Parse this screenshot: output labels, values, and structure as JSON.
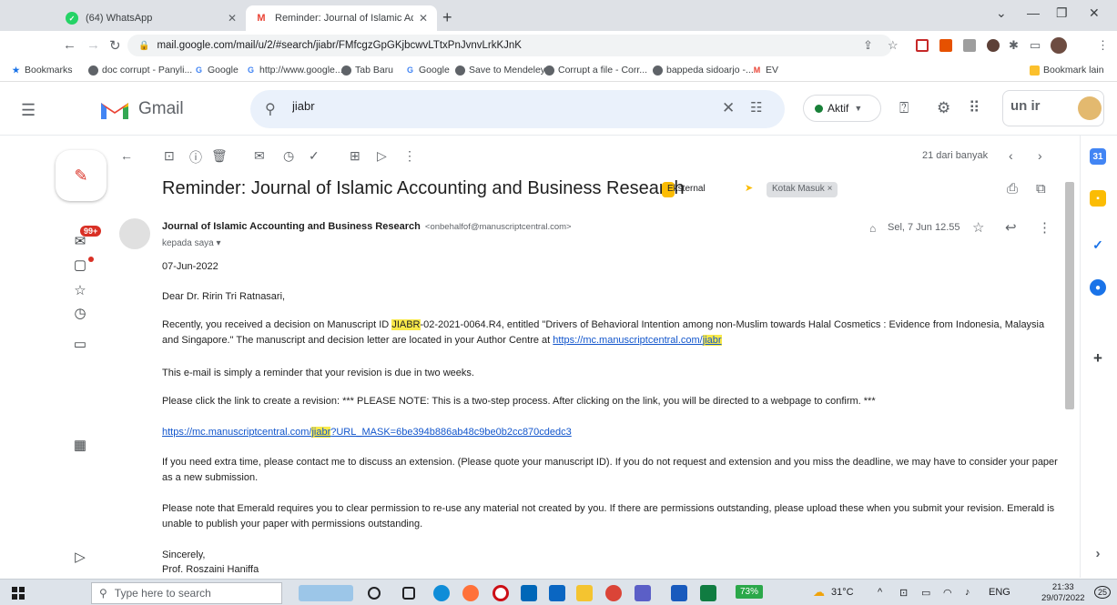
{
  "browser": {
    "tabs": [
      {
        "title": "(64) WhatsApp",
        "icon": "whatsapp-icon",
        "color": "#25d366"
      },
      {
        "title": "Reminder: Journal of Islamic Acc",
        "icon": "gmail-icon",
        "color": "#ea4335"
      }
    ],
    "url": "mail.google.com/mail/u/2/#search/jiabr/FMfcgzGpGKjbcwvLTtxPnJvnvLrkKJnK",
    "bookmarks": [
      "Bookmarks",
      "doc corrupt - Panyli...",
      "Google",
      "http://www.google....",
      "Tab Baru",
      "Google",
      "Save to Mendeley",
      "Corrupt a file - Corr...",
      "bappeda sidoarjo -...",
      "EV",
      "Bookmark lain"
    ]
  },
  "gmail": {
    "app_name": "Gmail",
    "search_value": "jiabr",
    "status_label": "Aktif",
    "status_color": "#188038",
    "org_logo_text": "un ir",
    "toolbar": {
      "pager_text": "21 dari banyak"
    },
    "unread_badge": "99+"
  },
  "email": {
    "subject": "Reminder: Journal of Islamic Accounting and Business Research",
    "labels": {
      "external": "Eksternal",
      "inbox": "Kotak Masuk ×"
    },
    "sender_name": "Journal of Islamic Accounting and Business Research",
    "sender_email": "<onbehalfof@manuscriptcentral.com>",
    "recipient": "kepada saya ▾",
    "date": "Sel, 7 Jun 12.55",
    "body": {
      "date_line": "07-Jun-2022",
      "greeting": "Dear Dr. Ririn Tri Ratnasari,",
      "p1_a": "Recently, you received a decision on Manuscript ID ",
      "p1_hl": "JIABR",
      "p1_b": "-02-2021-0064.R4, entitled \"Drivers of Behavioral Intention among non-Muslim towards Halal Cosmetics : Evidence from Indonesia, Malaysia and Singapore.\"  The manuscript and decision letter are located in your Author Centre at ",
      "p1_link_a": "https://mc.manuscriptcentral.com/",
      "p1_link_hl": "jiabr",
      "p2": "This e-mail is simply a reminder that your revision is due in two weeks.",
      "p3": "Please click the link to create a revision: *** PLEASE NOTE: This is a two-step process. After clicking on the link, you will be directed to a webpage to confirm. ***",
      "link2_a": "https://mc.manuscriptcentral.com/",
      "link2_hl": "jiabr",
      "link2_b": "?URL_MASK=6be394b886ab48c9be0b2cc870cdedc3",
      "p4": "If you need extra time, please contact me to discuss an extension. (Please quote your manuscript ID). If you do not request and extension and you miss the deadline, we may have to consider your paper as a new submission.",
      "p5": "Please note that Emerald requires you to clear permission to re-use any material not created by you.  If there are permissions outstanding, please upload these when you submit your revision. Emerald is unable to publish your paper with permissions outstanding.",
      "closing": "Sincerely,",
      "signature": "Prof. Roszaini Haniffa"
    }
  },
  "taskbar": {
    "search_placeholder": "Type here to search",
    "battery": "73%",
    "temperature": "31°C",
    "language": "ENG",
    "time": "21:33",
    "date": "29/07/2022",
    "notification_count": "25"
  }
}
